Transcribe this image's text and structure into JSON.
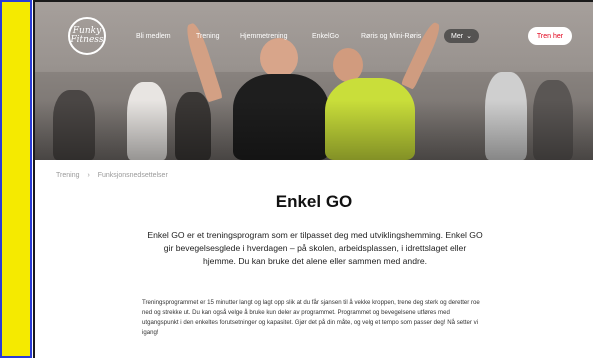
{
  "nav": {
    "logo_text": "Funky Fitness",
    "items": [
      "Bli medlem",
      "Trening",
      "Hjemmetrening",
      "EnkelGo",
      "Røris og Mini-Røris"
    ],
    "more_label": "Mer",
    "cta_label": "Tren her"
  },
  "breadcrumb": [
    "Trening",
    "›",
    "Funksjonsnedsettelser"
  ],
  "page": {
    "title": "Enkel GO",
    "intro": "Enkel GO er et treningsprogram som er tilpasset deg med utviklingshemming. Enkel GO gir bevegelsesglede i hverdagen – på skolen, arbeidsplassen, i idrettslaget eller hjemme. Du kan bruke det alene eller sammen med andre.",
    "body": "Treningsprogrammet er 15 minutter langt og lagt opp slik at du får sjansen til å vekke kroppen, trene deg sterk og deretter roe ned og strekke ut. Du kan også velge å bruke kun deler av programmet. Programmet og bevegelsene utføres med utgangspunkt i den enkeltes forutsetninger og kapasitet. Gjør det på din måte, og velg et tempo som passer deg! Nå setter vi igang!"
  },
  "colors": {
    "left_bar": "#f5ea00",
    "left_bar_border": "#2a3bd6",
    "cta_text": "#e2001a",
    "nav_pill": "#3c3c3c"
  }
}
